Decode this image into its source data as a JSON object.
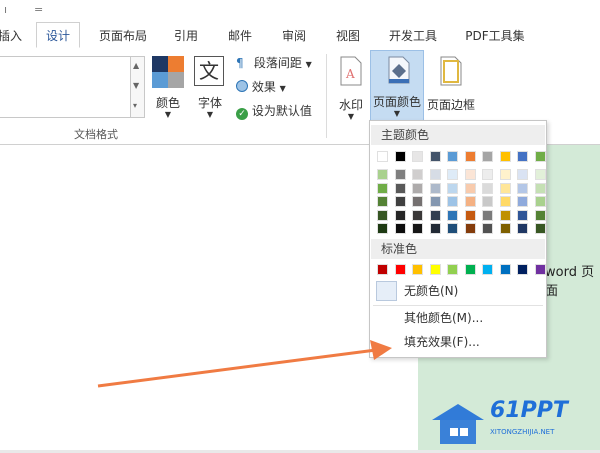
{
  "quick_access": {
    "undo_glyph": "ı",
    "customize_glyph": "="
  },
  "tabs": [
    {
      "label": "插入",
      "active": false
    },
    {
      "label": "设计",
      "active": true
    },
    {
      "label": "页面布局",
      "active": false
    },
    {
      "label": "引用",
      "active": false
    },
    {
      "label": "邮件",
      "active": false
    },
    {
      "label": "审阅",
      "active": false
    },
    {
      "label": "视图",
      "active": false
    },
    {
      "label": "开发工具",
      "active": false
    },
    {
      "label": "PDF工具集",
      "active": false
    }
  ],
  "ribbon": {
    "document_format": {
      "group_label": "文档格式",
      "colors_label": "颜色",
      "fonts_label": "字体",
      "fonts_glyph": "文",
      "paragraph_spacing_label": "段落间距",
      "effects_label": "效果",
      "set_default_label": "设为默认值"
    },
    "page_background": {
      "watermark_label": "水印",
      "page_color_label": "页面颜色",
      "page_borders_label": "页面边框"
    }
  },
  "dropdown": {
    "theme_colors_header": "主题颜色",
    "theme_top_row": [
      "#ffffff",
      "#000000",
      "#e7e6e6",
      "#44546a",
      "#5b9bd5",
      "#ed7d31",
      "#a5a5a5",
      "#ffc000",
      "#4472c4",
      "#70ad47"
    ],
    "theme_shades": [
      [
        "#a9d18e",
        "#7f7f7f",
        "#d0cece",
        "#d6dce5",
        "#deebf7",
        "#fbe5d6",
        "#ededed",
        "#fff2cc",
        "#dae3f3",
        "#e2f0d9"
      ],
      [
        "#70ad47",
        "#595959",
        "#aeabab",
        "#adb9ca",
        "#bdd7ee",
        "#f8cbad",
        "#dbdbdb",
        "#ffe699",
        "#b4c7e7",
        "#c5e0b4"
      ],
      [
        "#548235",
        "#404040",
        "#757171",
        "#8497b0",
        "#9dc3e6",
        "#f4b183",
        "#c9c9c9",
        "#ffd966",
        "#8faadc",
        "#a9d18e"
      ],
      [
        "#375623",
        "#262626",
        "#3a3838",
        "#333f50",
        "#2e75b6",
        "#c55a11",
        "#7b7b7b",
        "#bf9000",
        "#2f5597",
        "#548235"
      ],
      [
        "#1e3a13",
        "#0d0d0d",
        "#161616",
        "#222a35",
        "#1f4e79",
        "#843c0c",
        "#525252",
        "#7f6000",
        "#203864",
        "#385723"
      ]
    ],
    "standard_colors_header": "标准色",
    "standard_colors": [
      "#c00000",
      "#ff0000",
      "#ffc000",
      "#ffff00",
      "#92d050",
      "#00b050",
      "#00b0f0",
      "#0070c0",
      "#002060",
      "#7030a0"
    ],
    "no_color_label": "无颜色(N)",
    "more_colors_label": "其他颜色(M)...",
    "fill_effects_label": "填充效果(F)..."
  },
  "document": {
    "visible_text": "word 页面",
    "page_color": "#d3ead7"
  },
  "annotation_arrow": {
    "color": "#f07b43"
  },
  "watermark_logo": {
    "title": "61PPT",
    "subtitle": "XITONGZHIJIA.NET",
    "color": "#1f6fd8"
  }
}
